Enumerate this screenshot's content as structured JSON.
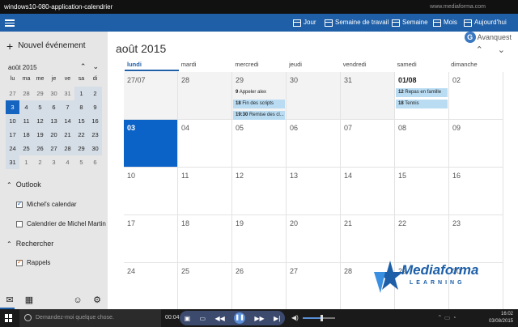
{
  "window": {
    "title": "windows10-080-application-calendrier",
    "brand": "www.mediaforma.com"
  },
  "toolbar": {
    "buttons": [
      {
        "label": "Jour"
      },
      {
        "label": "Semaine de travail"
      },
      {
        "label": "Semaine"
      },
      {
        "label": "Mois"
      },
      {
        "label": "Aujourd'hui"
      }
    ]
  },
  "sidebar": {
    "new_event": "Nouvel événement",
    "mini_month": "août 2015",
    "mini_dow": [
      "lu",
      "ma",
      "me",
      "je",
      "ve",
      "sa",
      "di"
    ],
    "mini_days": [
      "27",
      "28",
      "29",
      "30",
      "31",
      "1",
      "2",
      "3",
      "4",
      "5",
      "6",
      "7",
      "8",
      "9",
      "10",
      "11",
      "12",
      "13",
      "14",
      "15",
      "16",
      "17",
      "18",
      "19",
      "20",
      "21",
      "22",
      "23",
      "24",
      "25",
      "26",
      "27",
      "28",
      "29",
      "30",
      "31",
      "1",
      "2",
      "3",
      "4",
      "5",
      "6"
    ],
    "sections": [
      {
        "label": "Outlook"
      },
      {
        "label": "Rechercher"
      }
    ],
    "calendars": [
      {
        "label": "Michel's calendar",
        "checked": true
      },
      {
        "label": "Calendrier de Michel Martin",
        "checked": false
      },
      {
        "label": "Rappels",
        "checked": true
      }
    ]
  },
  "main": {
    "month_title": "août 2015",
    "dow": [
      "lundi",
      "mardi",
      "mercredi",
      "jeudi",
      "vendredi",
      "samedi",
      "dimanche"
    ],
    "weeks": [
      [
        "27/07",
        "28",
        "29",
        "30",
        "31",
        "01/08",
        "02"
      ],
      [
        "03",
        "04",
        "05",
        "06",
        "07",
        "08",
        "09"
      ],
      [
        "10",
        "11",
        "12",
        "13",
        "14",
        "15",
        "16"
      ],
      [
        "17",
        "18",
        "19",
        "20",
        "21",
        "22",
        "23"
      ],
      [
        "24",
        "25",
        "26",
        "27",
        "28",
        "29",
        "30"
      ]
    ],
    "events": {
      "wed": [
        {
          "time": "9",
          "title": "Appeler alex"
        },
        {
          "time": "18",
          "title": "Fin des scripts"
        },
        {
          "time": "19:30",
          "title": "Remise des cl..."
        }
      ],
      "sat": [
        {
          "time": "12",
          "title": "Repas en famille"
        },
        {
          "time": "18",
          "title": "Tennis"
        }
      ]
    },
    "logo": "Avanquest"
  },
  "watermark": {
    "name": "Mediaforma",
    "sub": "LEARNING"
  },
  "taskbar": {
    "search_placeholder": "Demandez-moi quelque chose.",
    "elapsed": "00:04",
    "clock_time": "16:02",
    "clock_date": "03/08/2015"
  }
}
